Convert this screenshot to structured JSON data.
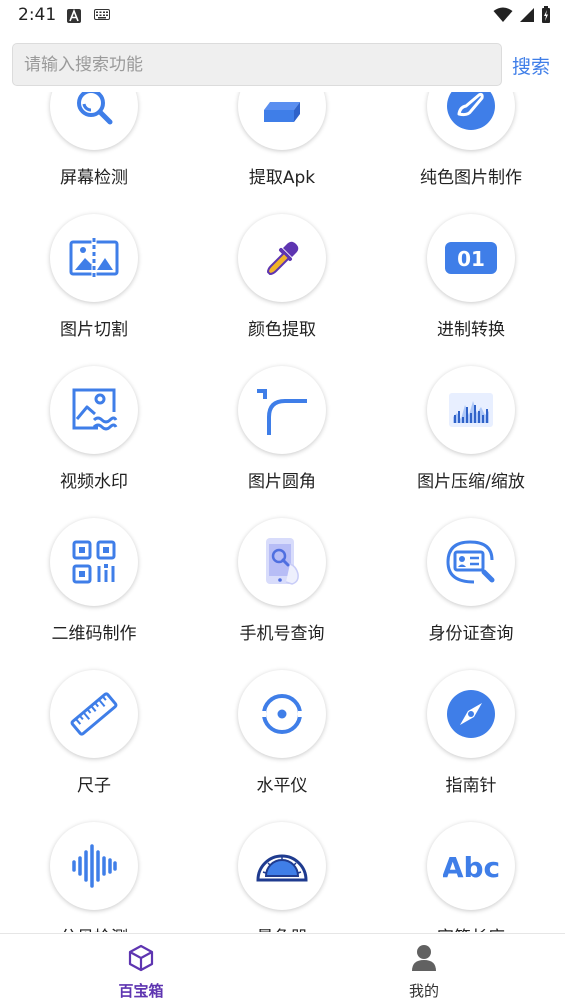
{
  "status_bar": {
    "time": "2:41"
  },
  "search": {
    "placeholder": "请输入搜索功能",
    "button_label": "搜索"
  },
  "tools": [
    {
      "label": "屏幕检测",
      "icon": "magnifier-icon"
    },
    {
      "label": "提取Apk",
      "icon": "package-icon"
    },
    {
      "label": "纯色图片制作",
      "icon": "brush-icon"
    },
    {
      "label": "图片切割",
      "icon": "image-split-icon"
    },
    {
      "label": "颜色提取",
      "icon": "eyedropper-icon"
    },
    {
      "label": "进制转换",
      "icon": "binary-icon",
      "icon_text": "01"
    },
    {
      "label": "视频水印",
      "icon": "image-watermark-icon"
    },
    {
      "label": "图片圆角",
      "icon": "rounded-corner-icon"
    },
    {
      "label": "图片压缩/缩放",
      "icon": "image-compress-icon"
    },
    {
      "label": "二维码制作",
      "icon": "qrcode-icon"
    },
    {
      "label": "手机号查询",
      "icon": "phone-search-icon"
    },
    {
      "label": "身份证查询",
      "icon": "id-card-search-icon"
    },
    {
      "label": "尺子",
      "icon": "ruler-icon"
    },
    {
      "label": "水平仪",
      "icon": "level-icon"
    },
    {
      "label": "指南针",
      "icon": "compass-icon"
    },
    {
      "label": "分贝检测",
      "icon": "sound-wave-icon"
    },
    {
      "label": "量角器",
      "icon": "protractor-icon"
    },
    {
      "label": "字符长度",
      "icon": "text-abc-icon",
      "icon_text": "Abc"
    }
  ],
  "bottom_nav": [
    {
      "label": "百宝箱",
      "icon": "box-icon",
      "active": true
    },
    {
      "label": "我的",
      "icon": "user-icon",
      "active": false
    }
  ],
  "colors": {
    "accent": "#3f7ee8",
    "nav_active": "#5e35b1",
    "icon_dark": "#4f6fe0"
  }
}
